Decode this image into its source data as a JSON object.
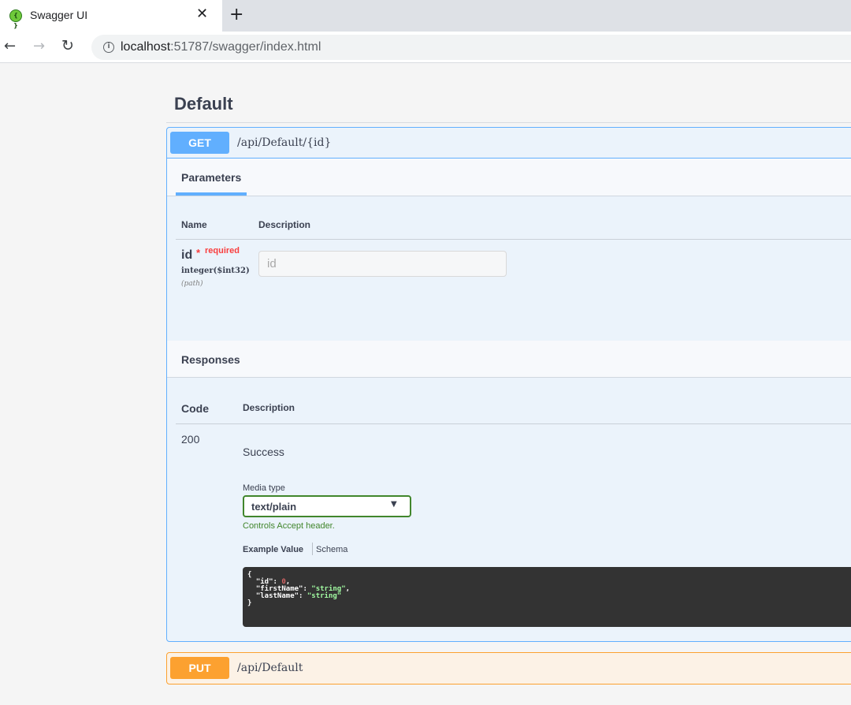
{
  "browser": {
    "tab_title": "Swagger UI",
    "favicon_glyph": "{ }",
    "close_glyph": "✕",
    "new_tab_glyph": "+",
    "back_glyph": "←",
    "forward_glyph": "→",
    "reload_glyph": "↻",
    "info_glyph": "i",
    "url_host": "localhost",
    "url_rest": ":51787/swagger/index.html"
  },
  "tag": {
    "title": "Default"
  },
  "get_op": {
    "method": "GET",
    "path": "/api/Default/{id}",
    "parameters_title": "Parameters",
    "col_name": "Name",
    "col_description": "Description",
    "param": {
      "name": "id",
      "star": "*",
      "required": "required",
      "type": "integer($int32)",
      "in": "(path)",
      "placeholder": "id"
    },
    "responses_title": "Responses",
    "resp_col_code": "Code",
    "resp_col_description": "Description",
    "response": {
      "code": "200",
      "description": "Success",
      "media_type_label": "Media type",
      "media_type_value": "text/plain",
      "accept_note": "Controls Accept header.",
      "example_tab": "Example Value",
      "schema_tab": "Schema",
      "example": {
        "open": "{",
        "id_key": "\"id\"",
        "id_val": "0",
        "first_key": "\"firstName\"",
        "first_val": "\"string\"",
        "last_key": "\"lastName\"",
        "last_val": "\"string\"",
        "close": "}"
      }
    }
  },
  "put_op": {
    "method": "PUT",
    "path": "/api/Default"
  },
  "colors": {
    "get": "#61affe",
    "put": "#fca130",
    "media_select_border": "#41862c",
    "required": "#f93e3e"
  }
}
